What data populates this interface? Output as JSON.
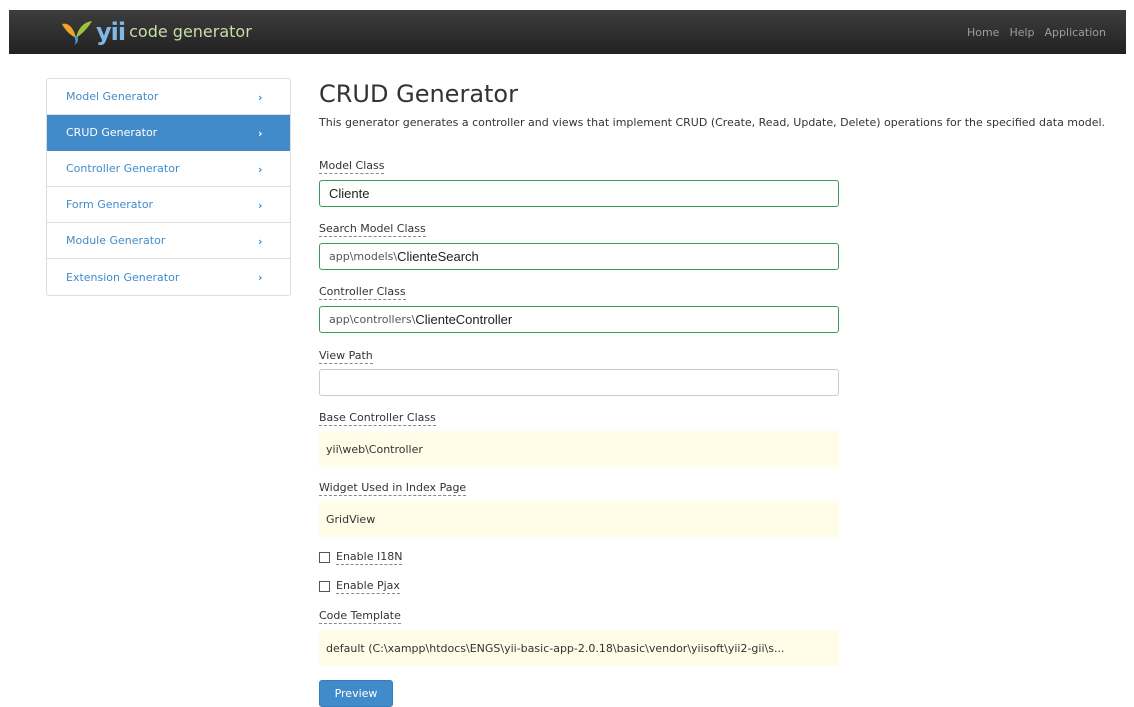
{
  "navbar": {
    "brand_yii": "yii",
    "brand_text": "code generator",
    "links": [
      "Home",
      "Help",
      "Application"
    ]
  },
  "sidebar": {
    "items": [
      {
        "label": "Model Generator",
        "chevron": "›"
      },
      {
        "label": "CRUD Generator",
        "chevron": "›"
      },
      {
        "label": "Controller Generator",
        "chevron": "›"
      },
      {
        "label": "Form Generator",
        "chevron": "›"
      },
      {
        "label": "Module Generator",
        "chevron": "›"
      },
      {
        "label": "Extension Generator",
        "chevron": "›"
      }
    ],
    "active_index": 1
  },
  "main": {
    "title": "CRUD Generator",
    "description": "This generator generates a controller and views that implement CRUD (Create, Read, Update, Delete) operations for the specified data model.",
    "model_class": {
      "label": "Model Class",
      "value": "Cliente"
    },
    "search_model_class": {
      "label": "Search Model Class",
      "prefix": "app\\models\\",
      "value": "ClienteSearch"
    },
    "controller_class": {
      "label": "Controller Class",
      "prefix": "app\\controllers\\",
      "value": "ClienteController"
    },
    "view_path": {
      "label": "View Path",
      "value": ""
    },
    "base_controller_class": {
      "label": "Base Controller Class",
      "value": "yii\\web\\Controller"
    },
    "widget_index_page": {
      "label": "Widget Used in Index Page",
      "value": "GridView"
    },
    "enable_i18n": {
      "label": "Enable I18N",
      "checked": false
    },
    "enable_pjax": {
      "label": "Enable Pjax",
      "checked": false
    },
    "code_template": {
      "label": "Code Template",
      "value": "default (C:\\xampp\\htdocs\\ENGS\\yii-basic-app-2.0.18\\basic\\vendor\\yiisoft\\yii2-gii\\s..."
    },
    "preview_label": "Preview"
  },
  "colors": {
    "navbar_bg": "#222222",
    "accent": "#428bca",
    "valid_border": "#3c9a5f",
    "sticky_bg": "#fffde8"
  }
}
